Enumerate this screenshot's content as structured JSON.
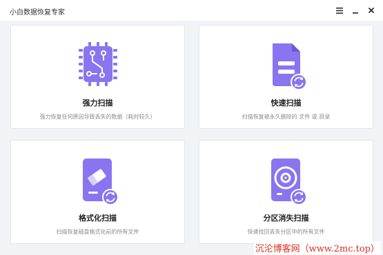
{
  "window": {
    "title": "小白数据恢复专家",
    "menu_icon": "hamburger-icon",
    "minimize_icon": "minimize-icon",
    "close_icon": "close-icon"
  },
  "colors": {
    "accent": "#8a74f0",
    "accent_dark": "#6c57d8",
    "background": "#f2f3f7",
    "card": "#ffffff",
    "watermark": "#d93020"
  },
  "cards": [
    {
      "title": "强力扫描",
      "description": "强力恢复任何原因导致丢失的数据（耗时较久）",
      "icon": "chip-circuit-icon"
    },
    {
      "title": "快速扫描",
      "description": "扫描恢复被永久删除的 文件 或 目录",
      "icon": "document-refresh-icon"
    },
    {
      "title": "格式化扫描",
      "description": "扫描恢复磁盘格式化前的所有文件",
      "icon": "eraser-disk-icon"
    },
    {
      "title": "分区消失扫描",
      "description": "快速找回丢失分区中的所有文件",
      "icon": "hard-disk-refresh-icon"
    }
  ],
  "watermark": "沉沦博客网（www.2mc.top）"
}
